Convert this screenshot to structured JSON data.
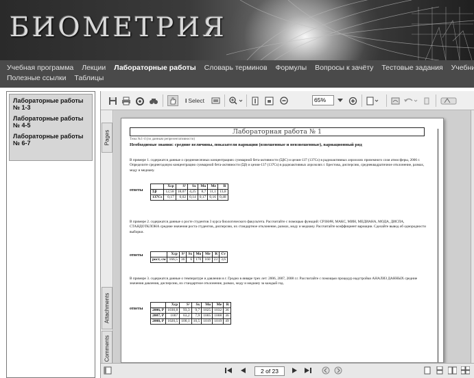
{
  "banner": {
    "title": "БИОМЕТРИЯ"
  },
  "nav": {
    "items": [
      {
        "label": "Учебная программа"
      },
      {
        "label": "Лекции"
      },
      {
        "label": "Лабораторные работы"
      },
      {
        "label": "Словарь терминов"
      },
      {
        "label": "Формулы"
      },
      {
        "label": "Вопросы к зачёту"
      },
      {
        "label": "Тестовые задания"
      },
      {
        "label": "Учебники"
      },
      {
        "label": "Полезные ссылки"
      },
      {
        "label": "Таблицы"
      }
    ],
    "active": "Лабораторные работы"
  },
  "sidebar": {
    "items": [
      {
        "label": "Лабораторные работы № 1-3"
      },
      {
        "label": "Лабораторные работы № 4-5"
      },
      {
        "label": "Лабораторные работы № 6-7"
      }
    ]
  },
  "toolbar": {
    "select_label": "Select",
    "zoom_value": "65%"
  },
  "side_tabs": {
    "pages": "Pages",
    "attachments": "Attachments",
    "comments": "Comments"
  },
  "document": {
    "title": "Лабораторная работа № 1",
    "topic": "Тема №1-4 (по данным репрезентативности)",
    "knowledge": "Необходимые знания: средние величины, показатели вариации (взвешенные и невзвешенные), вариационный ряд",
    "example1": "В примере 1. содержатся данные о среднемесячных концентрациях суммарной бета-активности (ΣβС) и цезия-137 (137Cs) в радиоактивных аэрозолях приземного слоя атмосферы, 2006 г. Определите среднегодовую концентрацию суммарной бета-активности (Σβ) и цезия-137 (137Cs) в радиоактивных аэрозолях г. Брестова, дисперсию, среднеквадратичное отклонение, размах, моду и медиану.",
    "example2": "В примере 2. содержатся данные о росте студентов 3 курса биологического факультета. Рассчитайте с помощью функций: СРЗНАЧ, МАКС, МИН, МЕДИАНА, МОДА, ДИСПА, СТАНДОТКЛОНА средние значения роста студентов, дисперсию, их стандартное отклонение, размах, моду и медиану. Рассчитайте коэффициент вариации. Сделайте вывод об однородности выборки.",
    "example3": "В примере 3. содержатся данные о температуре и давлении в г. Гродно в январе трех лет: 2006, 2007, 2008 г.г. Рассчитайте с помощью процедур надстройки АНАЛИЗ ДАННЫХ средние значения давления, дисперсию, их стандартное отклонение, размах, моду и медиану за каждый год.",
    "answers_label": "ответы",
    "table1": {
      "headers": [
        "",
        "Xср",
        "S²",
        "Sx",
        "Mo",
        "Me",
        "R"
      ],
      "rows": [
        [
          "Σβ",
          "12,58",
          "18,07",
          "4,25",
          "8,7",
          "11,1",
          "13,8"
        ],
        [
          "137Cs",
          "0,17",
          "0,02",
          "0,14",
          "0,17",
          "0,16",
          "0,48"
        ]
      ]
    },
    "table2": {
      "headers": [
        "",
        "Xср",
        "S²",
        "Sx",
        "Mo",
        "Me",
        "R",
        "Cv"
      ],
      "rows": [
        [
          "рост, см",
          "166,5",
          "36",
          "6",
          "170",
          "160",
          "23",
          "3,6"
        ]
      ]
    },
    "table3": {
      "headers": [
        "",
        "Xср",
        "S²",
        "Sx",
        "Mo",
        "Me",
        "R"
      ],
      "rows": [
        [
          "2006, P",
          "1030,8",
          "93,3",
          "9,7",
          "1025",
          "1032",
          "36"
        ],
        [
          "2007, P",
          "1007",
          "63,2",
          "7,9",
          "1005",
          "1008",
          "36"
        ],
        [
          "2008, P",
          "1020,5",
          "100,1",
          "10,5",
          "1019",
          "1019",
          "49"
        ]
      ]
    }
  },
  "bottombar": {
    "page_indicator": "2 of 23"
  }
}
